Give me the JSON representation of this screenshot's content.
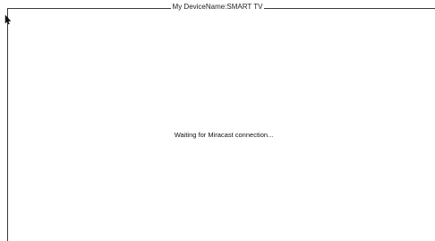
{
  "device": {
    "name_text": "My DeviceName:SMART TV"
  },
  "status": {
    "message": "Waiting for Miracast connection..."
  },
  "cursor": {
    "icon": "mouse-pointer-icon"
  },
  "colors": {
    "background": "#ffffff",
    "frame": "#3a3a3a",
    "text": "#111111"
  }
}
